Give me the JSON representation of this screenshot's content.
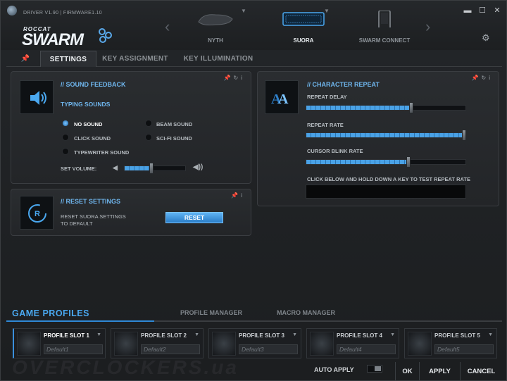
{
  "app": {
    "driver_text": "DRIVER V1.90 | FIRMWARE1.10",
    "logo_small": "ROCCAT",
    "logo_big": "SWARM"
  },
  "devices": [
    {
      "label": "NYTH"
    },
    {
      "label": "SUORA"
    },
    {
      "label": "SWARM CONNECT"
    }
  ],
  "window_controls": {
    "minimize": "▬",
    "maximize": "☐",
    "close": "✕"
  },
  "tabs": [
    {
      "label": "SETTINGS"
    },
    {
      "label": "KEY ASSIGNMENT"
    },
    {
      "label": "KEY ILLUMINATION"
    }
  ],
  "sound_feedback": {
    "title": "// SOUND FEEDBACK",
    "subtitle": "TYPING SOUNDS",
    "options": [
      {
        "label": "NO SOUND",
        "selected": true
      },
      {
        "label": "BEAM SOUND",
        "selected": false
      },
      {
        "label": "CLICK SOUND",
        "selected": false
      },
      {
        "label": "SCI-FI SOUND",
        "selected": false
      },
      {
        "label": "TYPEWRITER SOUND",
        "selected": false
      }
    ],
    "volume_label": "SET VOLUME:",
    "volume_level": 0.44
  },
  "reset_settings": {
    "title": "// RESET SETTINGS",
    "desc_line1": "RESET SUORA SETTINGS",
    "desc_line2": "TO DEFAULT",
    "button": "RESET"
  },
  "character_repeat": {
    "title": "// CHARACTER REPEAT",
    "repeat_delay_label": "REPEAT DELAY",
    "repeat_delay": 0.66,
    "repeat_rate_label": "REPEAT RATE",
    "repeat_rate": 0.99,
    "cursor_blink_label": "CURSOR BLINK RATE",
    "cursor_blink": 0.64,
    "test_label": "CLICK BELOW AND HOLD DOWN A KEY TO TEST REPEAT RATE"
  },
  "game_profiles": {
    "title": "GAME PROFILES",
    "tab_profile_manager": "PROFILE MANAGER",
    "tab_macro_manager": "MACRO MANAGER",
    "slots": [
      {
        "name": "PROFILE SLOT 1",
        "value": "Default1"
      },
      {
        "name": "PROFILE SLOT 2",
        "value": "Default2"
      },
      {
        "name": "PROFILE SLOT 3",
        "value": "Default3"
      },
      {
        "name": "PROFILE SLOT 4",
        "value": "Default4"
      },
      {
        "name": "PROFILE SLOT 5",
        "value": "Default5"
      }
    ]
  },
  "footer": {
    "watermark": "OVERCLOCKERS.ua",
    "auto_apply": "AUTO APPLY",
    "ok": "OK",
    "apply": "APPLY",
    "cancel": "CANCEL"
  },
  "colors": {
    "accent": "#4aa8f0",
    "slider": "#4aa2e6"
  }
}
